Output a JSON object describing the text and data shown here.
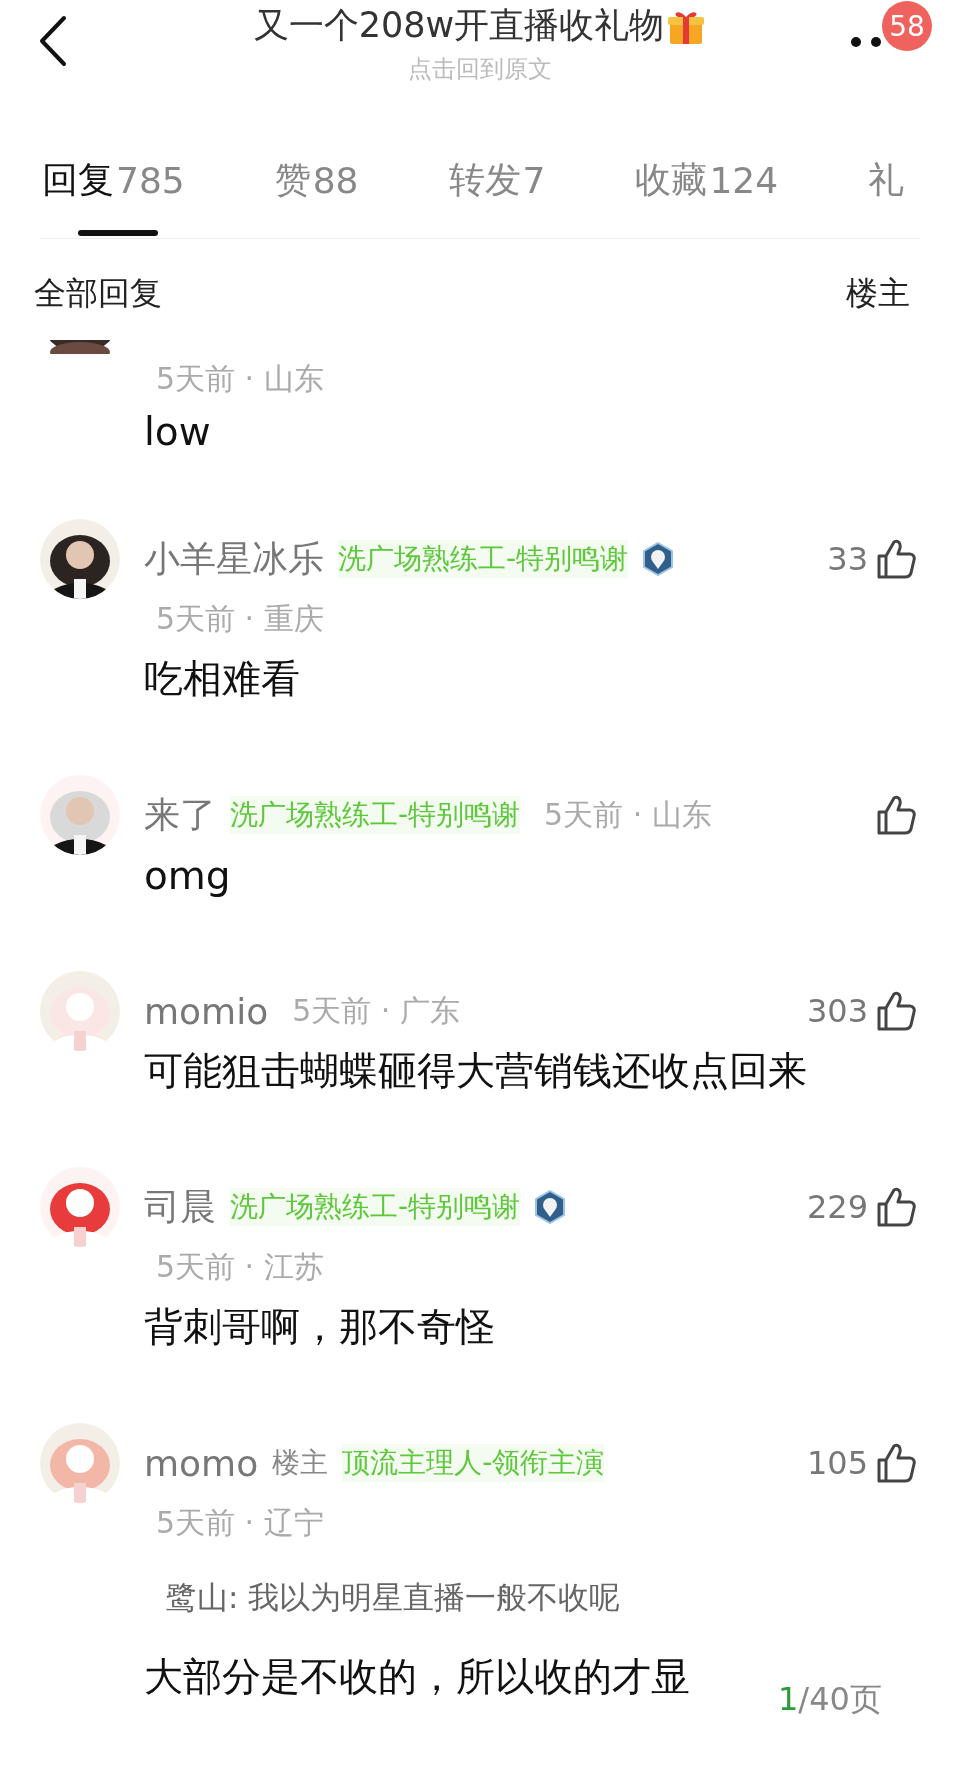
{
  "header": {
    "title": "又一个208w开直播收礼物",
    "subtitle": "点击回到原文",
    "notification_count": "58"
  },
  "tabs": [
    {
      "label": "回复",
      "count": "785",
      "selected": true
    },
    {
      "label": "赞",
      "count": "88",
      "selected": false
    },
    {
      "label": "转发",
      "count": "7",
      "selected": false
    },
    {
      "label": "收藏",
      "count": "124",
      "selected": false
    },
    {
      "label": "礼",
      "selected": false
    }
  ],
  "filter": {
    "left": "全部回复",
    "right": "楼主"
  },
  "comments": [
    {
      "partial": true,
      "meta": "5天前 · 山东",
      "text": "low"
    },
    {
      "name": "小羊星冰乐",
      "badge": "洗广场熟练工-特别鸣谢",
      "medal": true,
      "likes": "33",
      "meta": "5天前 · 重庆",
      "meta_inline": false,
      "text": "吃相难看"
    },
    {
      "name": "来了",
      "badge": "洗广场熟练工-特别鸣谢",
      "medal": false,
      "meta": "5天前 · 山东",
      "meta_inline": true,
      "text": "omg"
    },
    {
      "name": "momio",
      "likes": "303",
      "meta": "5天前 · 广东",
      "meta_inline": true,
      "text": "可能狙击蝴蝶砸得大营销钱还收点回来"
    },
    {
      "name": "司晨",
      "badge": "洗广场熟练工-特别鸣谢",
      "medal": true,
      "likes": "229",
      "meta": "5天前 · 江苏",
      "meta_inline": false,
      "text": "背刺哥啊，那不奇怪"
    },
    {
      "name": "momo",
      "op_label": "楼主",
      "badge": "顶流主理人-领衔主演",
      "medal": false,
      "likes": "105",
      "meta": "5天前 · 辽宁",
      "meta_inline": false,
      "quote": "鹭山: 我以为明星直播一般不收呢",
      "text": "大部分是不收的，所以收的才显"
    }
  ],
  "pager": {
    "current": "1",
    "total": "/40页"
  }
}
